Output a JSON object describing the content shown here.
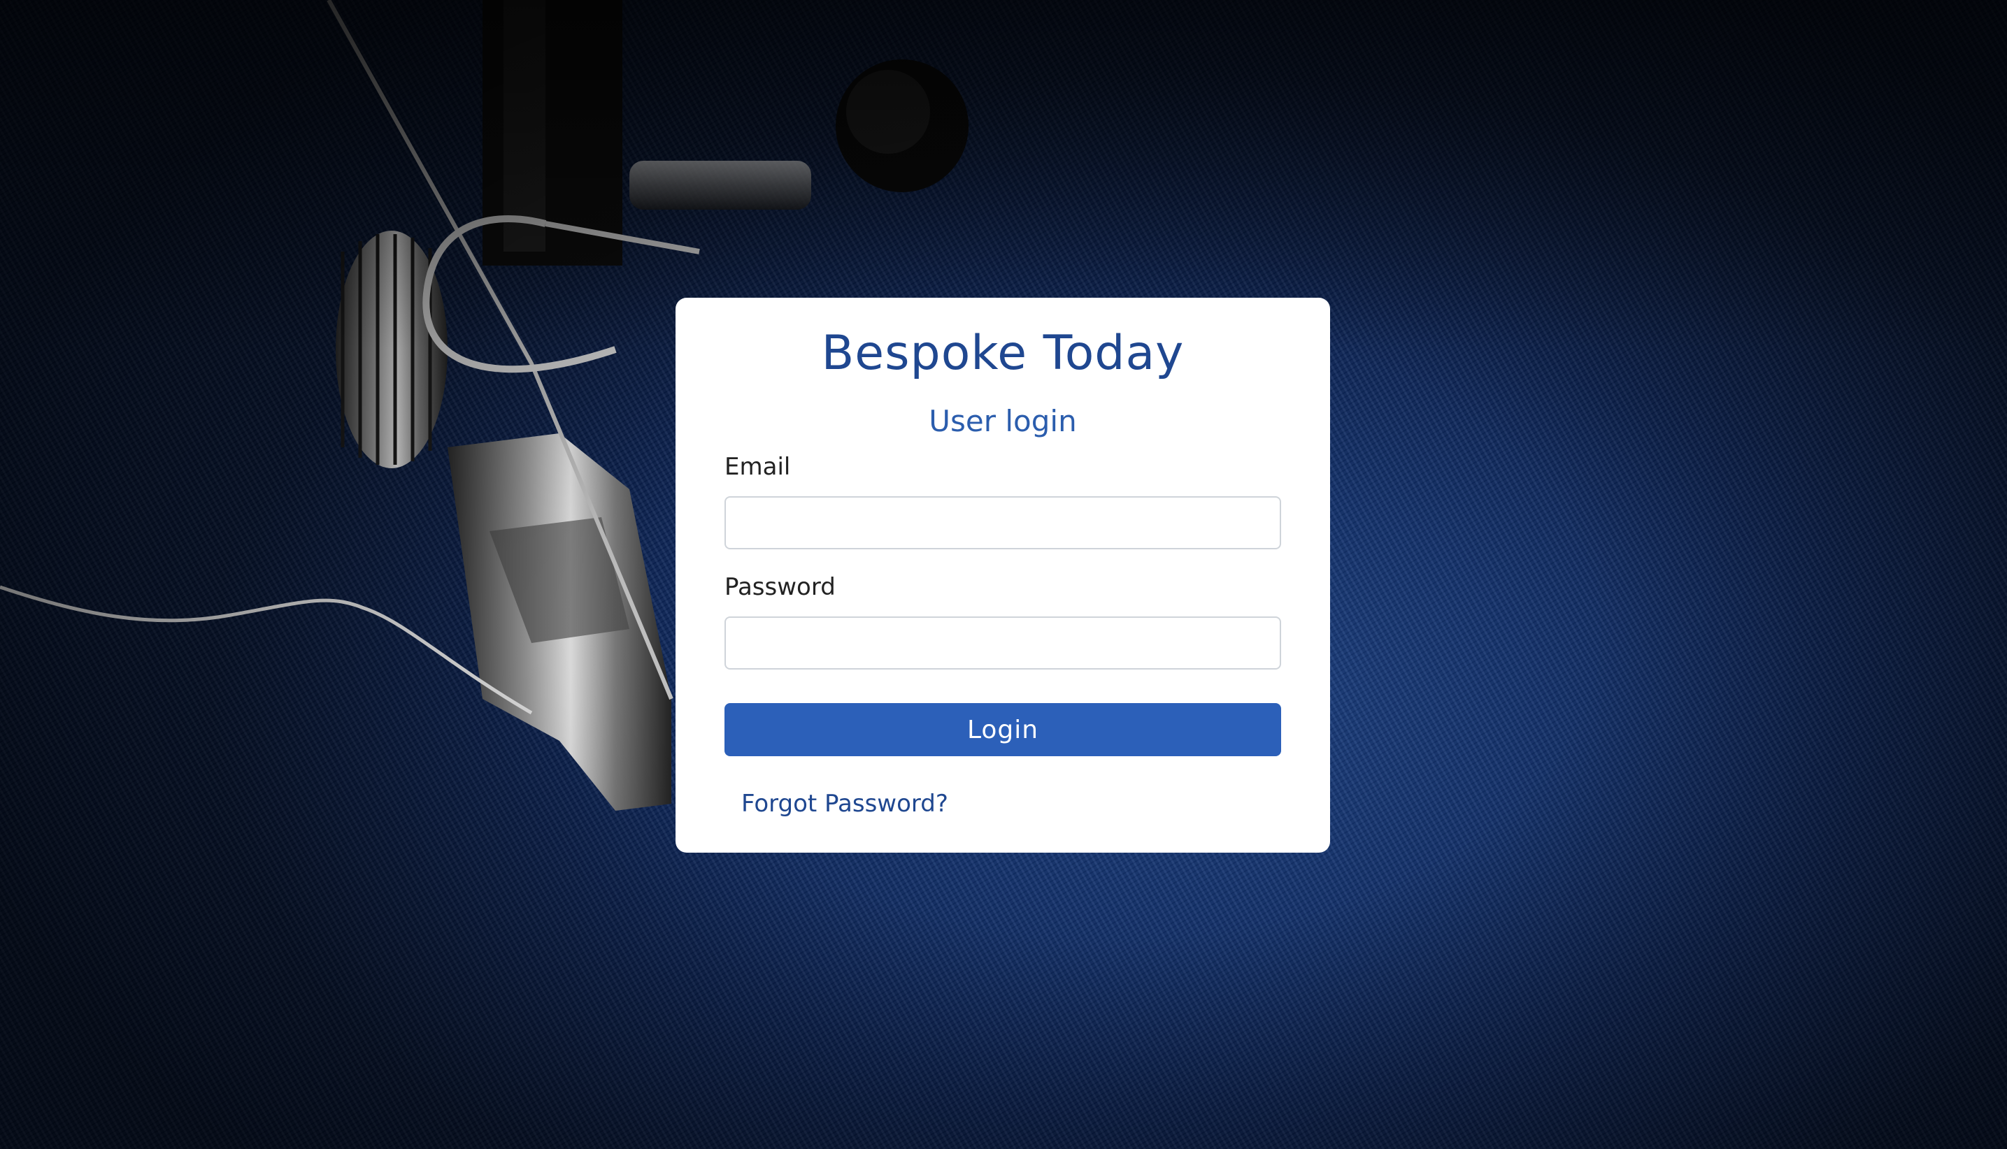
{
  "page": {
    "brand": "Bespoke Today",
    "subtitle": "User login"
  },
  "form": {
    "email_label": "Email",
    "email_value": "",
    "email_placeholder": "",
    "password_label": "Password",
    "password_value": "",
    "password_placeholder": "",
    "login_label": "Login",
    "forgot_label": "Forgot Password?"
  },
  "colors": {
    "brand": "#1f4790",
    "button": "#2c60b9",
    "background": "#0b2150"
  },
  "background_image": "sewing-machine-presser-foot-on-navy-fabric"
}
